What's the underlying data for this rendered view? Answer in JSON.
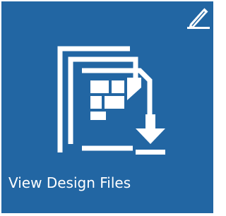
{
  "tile": {
    "label": "View Design Files",
    "background_color": "#2266a3",
    "foreground_color": "#ffffff",
    "icon": "design-files-download-icon",
    "edit_icon": "pencil-icon"
  }
}
